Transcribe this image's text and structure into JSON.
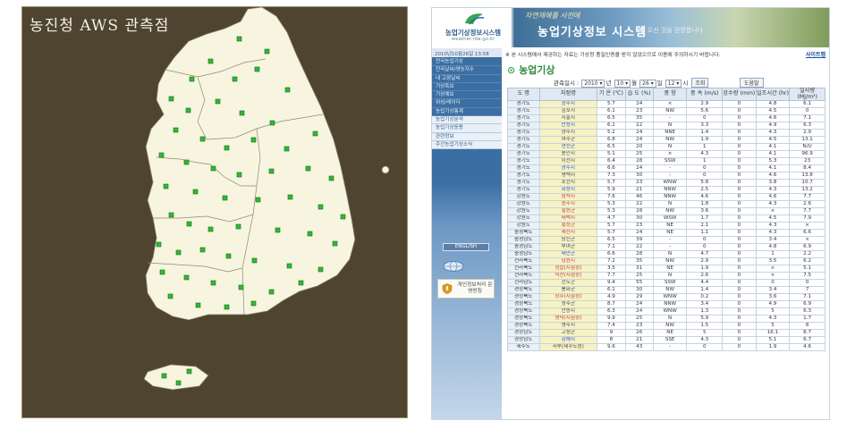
{
  "map": {
    "title": "농진청 AWS 관측점"
  },
  "colors": {
    "map_background": "#4e4430",
    "land": "#f7f4df",
    "station_marker": "#2dbb36",
    "banner_blue": "#3f6f96",
    "sidebar_blue": "#3b6fa4",
    "header_cell": "#dfe9f3",
    "station_cell": "#f6f2c4",
    "title_green": "#2e8a3a"
  },
  "site": {
    "logo_title": "농업기상정보시스템",
    "logo_url": "weather.rda.go.kr",
    "banner_subtitle": "자연재해를 사전에",
    "banner_title": "농업기상정보 시스템",
    "banner_tagline": "에 오신 것을 환영합니다",
    "date_line": "2010년10월26일 13:58"
  },
  "sidebar": {
    "items": [
      {
        "label": "전국농업기상"
      },
      {
        "label": "전국날씨/영농지수"
      },
      {
        "label": "내 고장날씨"
      },
      {
        "label": "기상특보"
      },
      {
        "label": "기상예보"
      },
      {
        "label": "위성/레이더"
      },
      {
        "label": "농업기상통계"
      },
      {
        "label": "농업기상분석"
      },
      {
        "label": "농업기상응용"
      },
      {
        "label": "관련정보"
      },
      {
        "label": "주간농업기상소식"
      }
    ],
    "english_label": "ENGLISH",
    "privacy_label": "개인정보처리 운영방침"
  },
  "content": {
    "notice": "※ 본 시스템에서 제공하는 자료는 기상청 품질인증을 받지 않았으므로 이용에 주의하시기 바랍니다.",
    "notice_link": "사이트맵",
    "section_title": "농업기상",
    "query": {
      "label": "관측일시 :",
      "year": "2010",
      "year_unit": "년",
      "month": "10",
      "month_unit": "월",
      "day": "26",
      "day_unit": "일",
      "hour": "12",
      "hour_unit": "시",
      "search_button": "조회"
    },
    "help_button": "도움말",
    "table": {
      "headers": [
        "도 명",
        "지점명",
        "기 온 (℃)",
        "습 도 (%)",
        "풍 향",
        "풍 속 (m/s)",
        "강수량 (mm)",
        "일조시간 (hr)",
        "일사량 (MJ/m²)"
      ],
      "rows": [
        [
          "경기도",
          "광주시",
          "5.7",
          "24",
          "×",
          "2.9",
          "0",
          "4.8",
          "6.1"
        ],
        [
          "경기도",
          "김포시",
          "6.1",
          "23",
          "NW",
          "5.6",
          "0",
          "4.5",
          "0"
        ],
        [
          "경기도",
          "시흥시",
          "6.5",
          "35",
          "-",
          "0",
          "0",
          "4.6",
          "7.1"
        ],
        [
          "경기도",
          "안성시",
          "6.2",
          "22",
          "N",
          "3.3",
          "0",
          "4.9",
          "6.3"
        ],
        [
          "경기도",
          "양주시",
          "5.2",
          "24",
          "NNE",
          "1.4",
          "0",
          "4.3",
          "2.9"
        ],
        [
          "경기도",
          "여주군",
          "6.8",
          "24",
          "NW",
          "1.9",
          "0",
          "4.5",
          "13.1"
        ],
        [
          "경기도",
          "연천군",
          "6.5",
          "20",
          "N",
          "1",
          "0",
          "4.1",
          "N/U"
        ],
        [
          "경기도",
          "용인시",
          "5.1",
          "25",
          "×",
          "4.3",
          "0",
          "4.1",
          "96.9"
        ],
        [
          "경기도",
          "이천시",
          "6.4",
          "28",
          "SSW",
          "1",
          "0",
          "5.3",
          "23"
        ],
        [
          "경기도",
          "광주시",
          "6.6",
          "24",
          "-",
          "0",
          "0",
          "4.1",
          "8.4"
        ],
        [
          "경기도",
          "평택시",
          "7.3",
          "30",
          "-",
          "0",
          "0",
          "4.6",
          "13.8"
        ],
        [
          "경기도",
          "포천시",
          "5.7",
          "23",
          "WNW",
          "5.8",
          "0",
          "3.8",
          "10.7"
        ],
        [
          "경기도",
          "화성시",
          "5.9",
          "21",
          "NNW",
          "2.5",
          "0",
          "4.3",
          "13.2"
        ],
        [
          "강원도",
          "삼척시",
          "7.6",
          "46",
          "NNW",
          "4.6",
          "0",
          "4.6",
          "7.7"
        ],
        [
          "강원도",
          "원주시",
          "5.3",
          "22",
          "N",
          "1.8",
          "0",
          "4.3",
          "2.6"
        ],
        [
          "강원도",
          "철원군",
          "5.3",
          "28",
          "NW",
          "3.6",
          "0",
          "×",
          "7.7"
        ],
        [
          "강원도",
          "태백시",
          "4.7",
          "30",
          "WSW",
          "1.7",
          "0",
          "4.5",
          "7.9"
        ],
        [
          "강원도",
          "횡성군",
          "5.7",
          "23",
          "NE",
          "2.1",
          "0",
          "4.3",
          "×"
        ],
        [
          "충청북도",
          "제천시",
          "5.7",
          "24",
          "NE",
          "1.1",
          "0",
          "4.3",
          "6.6"
        ],
        [
          "충청남도",
          "당진군",
          "6.5",
          "39",
          "-",
          "0",
          "0",
          "3.4",
          "×"
        ],
        [
          "충청남도",
          "부여군",
          "7.1",
          "22",
          "-",
          "0",
          "0",
          "4.8",
          "6.9"
        ],
        [
          "충청남도",
          "태안군",
          "6.6",
          "28",
          "N",
          "4.7",
          "0",
          "1",
          "2.2"
        ],
        [
          "전라북도",
          "남원시",
          "7.2",
          "35",
          "NW",
          "2.9",
          "0",
          "3.5",
          "6.2"
        ],
        [
          "전라북도",
          "정읍(시험장)",
          "3.5",
          "31",
          "NE",
          "1.9",
          "0",
          "×",
          "5.1"
        ],
        [
          "전라북도",
          "익산(시험장)",
          "7.7",
          "25",
          "N",
          "2.6",
          "0",
          "×",
          "7.5"
        ],
        [
          "전라남도",
          "진도군",
          "9.4",
          "55",
          "SSW",
          "4.4",
          "0",
          "0",
          "0"
        ],
        [
          "경상북도",
          "봉화군",
          "6.1",
          "30",
          "NW",
          "1.4",
          "0",
          "3.4",
          "7"
        ],
        [
          "경상북도",
          "상주(시험장)",
          "4.9",
          "29",
          "WNW",
          "0.2",
          "0",
          "3.6",
          "7.1"
        ],
        [
          "경상북도",
          "성주군",
          "8.7",
          "24",
          "NNW",
          "3.4",
          "0",
          "4.9",
          "6.9"
        ],
        [
          "경상북도",
          "안동시",
          "6.3",
          "24",
          "WNW",
          "1.3",
          "0",
          "5",
          "6.3"
        ],
        [
          "경상북도",
          "영덕(시험장)",
          "9.9",
          "25",
          "N",
          "5.9",
          "0",
          "4.3",
          "1.7"
        ],
        [
          "경상북도",
          "영주시",
          "7.4",
          "23",
          "NW",
          "1.5",
          "0",
          "5",
          "8"
        ],
        [
          "경상남도",
          "고성군",
          "9",
          "26",
          "NE",
          "5",
          "0",
          "16.1",
          "8.7"
        ],
        [
          "경상남도",
          "김해시",
          "8",
          "21",
          "SSE",
          "4.3",
          "0",
          "5.1",
          "6.7"
        ],
        [
          "제주도",
          "서부(제주도원)",
          "9.6",
          "43",
          "-",
          "0",
          "0",
          "1.9",
          "4.6"
        ]
      ]
    }
  }
}
